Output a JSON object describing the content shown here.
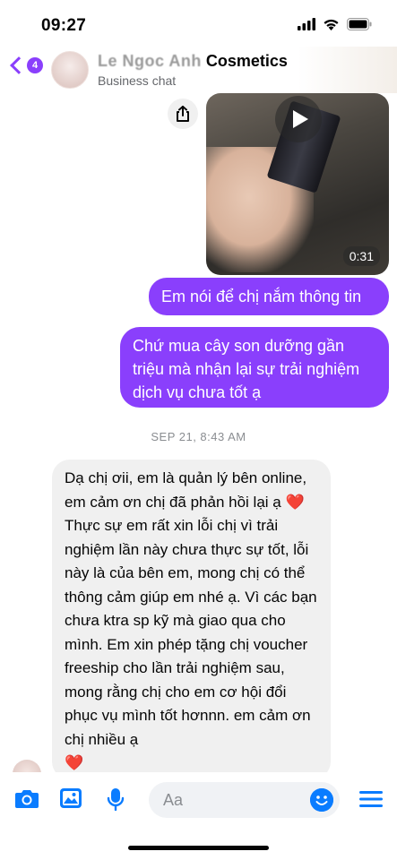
{
  "status_bar": {
    "time": "09:27"
  },
  "header": {
    "back_badge": "4",
    "title_blurred": "Le Ngoc Anh",
    "title": "Cosmetics",
    "subtitle": "Business chat"
  },
  "video_message": {
    "duration": "0:31"
  },
  "messages": {
    "outgoing_1": "Em nói để chị nắm thông tin",
    "outgoing_2": "Chứ mua cây son dưỡng gần\ntriệu mà nhận lại sự trải nghiệm\ndịch vụ chưa tốt ạ",
    "timestamp": "SEP 21, 8:43 AM",
    "incoming_1_part1": "Dạ chị ơii, em là quản lý bên online, em cảm ơn chị đã phản hồi lại ạ",
    "incoming_1_part2": "Thực sự em rất xin lỗi chị vì trải nghiệm lần này chưa thực sự tốt, lỗi này là của bên em, mong chị có thể thông cảm giúp em nhé ạ. Vì các bạn chưa ktra sp kỹ mà giao qua cho mình. Em xin phép tặng chị voucher freeship cho lần trải nghiệm sau, mong rằng chị cho em cơ hội đổi phục vụ mình tốt hơnnn. em cảm ơn chị nhiều ạ",
    "heart_emoji": "❤️"
  },
  "composer": {
    "placeholder": "Aa"
  },
  "colors": {
    "accent": "#8a3ffc",
    "messenger_blue": "#0a7cff"
  },
  "icons": [
    "signal-icon",
    "wifi-icon",
    "battery-icon",
    "back-chevron-icon",
    "share-icon",
    "play-icon",
    "camera-icon",
    "gallery-icon",
    "microphone-icon",
    "emoji-icon",
    "menu-icon"
  ]
}
